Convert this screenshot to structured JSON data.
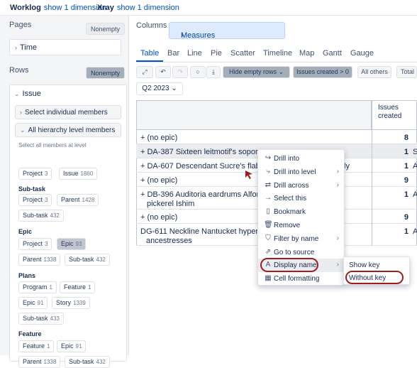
{
  "topbar": {
    "worklog_label": "Worklog",
    "worklog_link": "show 1 dimension",
    "xray_label": "Xray",
    "xray_link": "show 1 dimension"
  },
  "left": {
    "pages_title": "Pages",
    "pages_button": "Nonempty",
    "time_label": "Time",
    "rows_title": "Rows",
    "rows_button": "Nonempty",
    "issue_label": "Issue",
    "select_individual": "Select individual members",
    "all_hierarchy": "All hierarchy level members",
    "select_all_hint": "Select all members at level",
    "top_chips": [
      {
        "label": "Project",
        "count": "3"
      },
      {
        "label": "Issue",
        "count": "1860"
      }
    ],
    "groups": [
      {
        "title": "Sub-task",
        "chips": [
          {
            "label": "Project",
            "count": "3"
          },
          {
            "label": "Parent",
            "count": "1428"
          },
          {
            "label": "Sub-task",
            "count": "432"
          }
        ]
      },
      {
        "title": "Epic",
        "chips": [
          {
            "label": "Project",
            "count": "3"
          },
          {
            "label": "Epic",
            "count": "93"
          },
          {
            "label": "Parent",
            "count": "1338"
          },
          {
            "label": "Sub-task",
            "count": "432"
          }
        ]
      },
      {
        "title": "Plans",
        "chips": [
          {
            "label": "Program",
            "count": "1"
          },
          {
            "label": "Feature",
            "count": "1"
          },
          {
            "label": "Epic",
            "count": "91"
          },
          {
            "label": "Story",
            "count": "1339"
          },
          {
            "label": "Sub-task",
            "count": "433"
          }
        ]
      },
      {
        "title": "Feature",
        "chips": [
          {
            "label": "Feature",
            "count": "1"
          },
          {
            "label": "Epic",
            "count": "91"
          },
          {
            "label": "Parent",
            "count": "1338"
          },
          {
            "label": "Sub-task",
            "count": "432"
          }
        ]
      }
    ]
  },
  "columns": {
    "title": "Columns",
    "measures": "Measures"
  },
  "tabs": [
    "Table",
    "Bar",
    "Line",
    "Pie",
    "Scatter",
    "Timeline",
    "Map",
    "Gantt",
    "Gauge"
  ],
  "toolbar": {
    "hide_empty_rows": "Hide empty rows",
    "issues_created_filter": "Issues created > 0",
    "all_others": "All others",
    "total": "Total"
  },
  "period_select": "Q2 2023",
  "table": {
    "column_header": "Issues created",
    "rows": [
      {
        "label": "+ (no epic)",
        "value": "8",
        "ext": ""
      },
      {
        "label": "+ DA-387 Sixteen leitmotif's sopor",
        "trail": "s",
        "value": "1",
        "ext": "S"
      },
      {
        "label": "+ DA-607 Descendant Sucre's flabbe",
        "trail": "tly",
        "value": "1",
        "ext": "A"
      },
      {
        "label": "+ (no epic)",
        "value": "9",
        "ext": ""
      },
      {
        "label": "+ DB-396 Auditoria eardrums Alfonso",
        "label2": "pickerel Ishim",
        "value": "1",
        "ext": "A"
      },
      {
        "label": "+ (no epic)",
        "value": "9",
        "ext": ""
      },
      {
        "label": "DG-611 Neckline Nantucket hyperc",
        "label2": "ancestresses",
        "value": "1",
        "ext": "A"
      }
    ]
  },
  "context_menu": {
    "items": [
      {
        "label": "Drill into",
        "icon": "drill-into-icon",
        "glyph": "↪",
        "arrow": false
      },
      {
        "label": "Drill into level",
        "icon": "drill-level-icon",
        "glyph": "⤷",
        "arrow": true
      },
      {
        "label": "Drill across",
        "icon": "drill-across-icon",
        "glyph": "⇄",
        "arrow": true
      },
      {
        "label": "Select this",
        "icon": "arrow-right-icon",
        "glyph": "→",
        "arrow": false
      },
      {
        "label": "Bookmark",
        "icon": "bookmark-icon",
        "glyph": "▯",
        "arrow": false
      },
      {
        "label": "Remove",
        "icon": "trash-icon",
        "glyph": "🗑",
        "arrow": false
      },
      {
        "label": "Filter by name",
        "icon": "filter-icon",
        "glyph": "⛉",
        "arrow": true
      },
      {
        "label": "Go to source",
        "icon": "external-link-icon",
        "glyph": "⇗",
        "arrow": false
      },
      {
        "label": "Display name",
        "icon": "text-icon",
        "glyph": "A",
        "arrow": true
      },
      {
        "label": "Cell formatting",
        "icon": "grid-icon",
        "glyph": "▦",
        "arrow": false
      }
    ]
  },
  "submenu": {
    "show_key": "Show key",
    "without_key": "Without key"
  },
  "colors": {
    "accent": "#0052cc",
    "highlight_oval": "#a11c1c"
  }
}
